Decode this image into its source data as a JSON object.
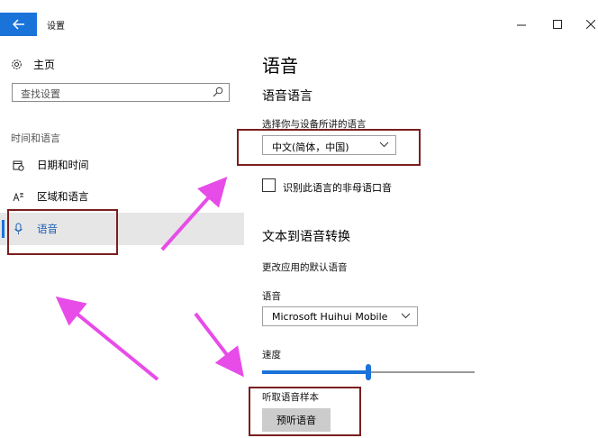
{
  "window": {
    "title": "设置"
  },
  "sidebar": {
    "home_label": "主页",
    "search_placeholder": "查找设置",
    "section_label": "时间和语言",
    "items": [
      {
        "label": "日期和时间",
        "icon": "clock-calendar-icon"
      },
      {
        "label": "区域和语言",
        "icon": "language-icon"
      },
      {
        "label": "语音",
        "icon": "microphone-icon",
        "selected": true
      }
    ]
  },
  "main": {
    "page_title": "语音",
    "speech_language": {
      "heading": "语音语言",
      "choose_label": "选择你与设备所讲的语言",
      "selected_language": "中文(简体，中国)",
      "checkbox_label": "识别此语言的非母语口音",
      "checkbox_checked": false
    },
    "tts": {
      "heading": "文本到语音转换",
      "description": "更改应用的默认语音",
      "voice_label": "语音",
      "voice_value": "Microsoft Huihui Mobile",
      "speed_label": "速度",
      "speed_fraction": 0.5,
      "sample_label": "听取语音样本",
      "preview_button": "预听语音"
    }
  },
  "colors": {
    "accent": "#1a73d9",
    "annotation_box": "#7a1f1f",
    "annotation_arrow": "#e84ce8"
  }
}
